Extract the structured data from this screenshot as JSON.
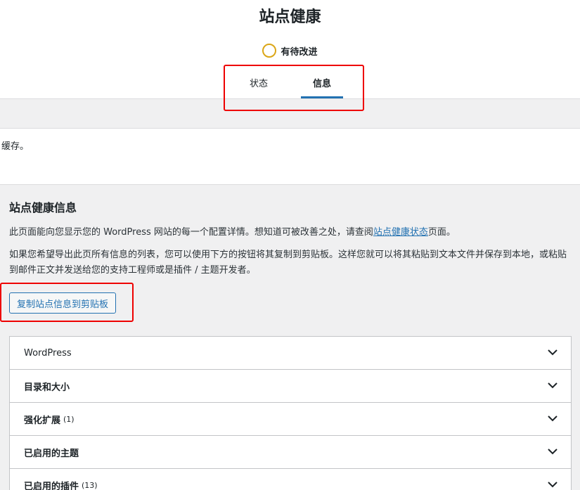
{
  "header": {
    "title": "站点健康",
    "status_text": "有待改进",
    "status_color": "#dba617"
  },
  "tabs": [
    {
      "label": "状态",
      "active": false
    },
    {
      "label": "信息",
      "active": true
    }
  ],
  "notice": {
    "text": "缓存。"
  },
  "section": {
    "title": "站点健康信息",
    "para1_prefix": "此页面能向您显示您的 WordPress 网站的每一个配置详情。想知道可被改善之处，请查阅",
    "para1_link": "站点健康状态",
    "para1_suffix": "页面。",
    "para2": "如果您希望导出此页所有信息的列表，您可以使用下方的按钮将其复制到剪贴板。这样您就可以将其粘贴到文本文件并保存到本地，或粘贴到邮件正文并发送给您的支持工程师或是插件 / 主题开发者。",
    "copy_button": "复制站点信息到剪贴板"
  },
  "accordion": [
    {
      "label": "WordPress",
      "count": ""
    },
    {
      "label": "目录和大小",
      "count": ""
    },
    {
      "label": "强化扩展",
      "count": "(1)"
    },
    {
      "label": "已启用的主题",
      "count": ""
    },
    {
      "label": "已启用的插件",
      "count": "(13)"
    }
  ],
  "colors": {
    "accent": "#2271b1",
    "highlight": "#ee0000"
  }
}
